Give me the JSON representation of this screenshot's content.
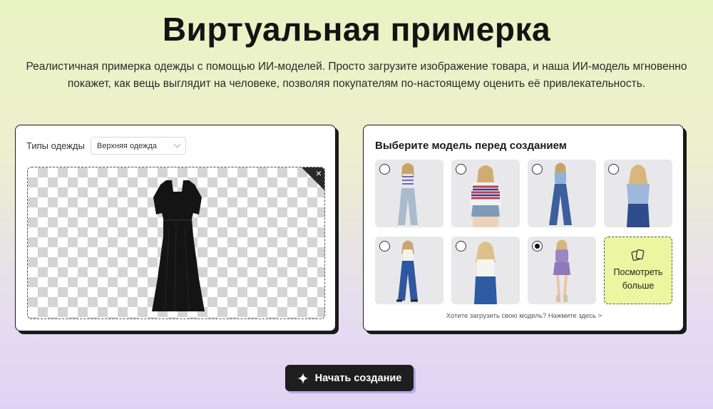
{
  "header": {
    "title": "Виртуальная примерка",
    "subtitle": "Реалистичная примерка одежды с помощью ИИ-моделей. Просто загрузите изображение товара, и наша ИИ-модель мгновенно покажет, как вещь выглядит на человеке, позволяя покупателям по-настоящему оценить её привлекательность."
  },
  "upload_panel": {
    "type_label": "Типы одежды",
    "type_selected": "Верхняя одежда",
    "image_subject": "black dress"
  },
  "model_panel": {
    "title": "Выберите модель перед созданием",
    "models": [
      {
        "selected": false,
        "outfit": "striped top, light jeans"
      },
      {
        "selected": false,
        "outfit": "patterned knit, denim shorts"
      },
      {
        "selected": false,
        "outfit": "blue top, flared jeans"
      },
      {
        "selected": false,
        "outfit": "blue top, jeans"
      },
      {
        "selected": false,
        "outfit": "white top, flared jeans"
      },
      {
        "selected": false,
        "outfit": "white tank, jeans"
      },
      {
        "selected": true,
        "outfit": "purple floral set"
      }
    ],
    "more_label": "Посмотреть больше",
    "upload_link": "Хотите загрузить свою модель? Нажмите здесь"
  },
  "actions": {
    "start_label": "Начать создание"
  },
  "colors": {
    "accent_tile": "#eaf7a0",
    "button_bg": "#1e1e1e",
    "button_shadow": "#b8a6e6"
  }
}
